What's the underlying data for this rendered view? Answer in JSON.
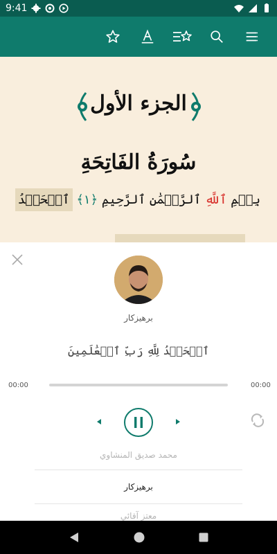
{
  "status_bar": {
    "time": "9:41",
    "left_icons": [
      "gear-icon",
      "at-sign-icon",
      "play-circle-icon"
    ],
    "right_icons": [
      "wifi-icon",
      "cellular-icon",
      "battery-icon"
    ]
  },
  "toolbar": {
    "actions": [
      "menu-icon",
      "search-icon",
      "starred-list-icon",
      "font-icon",
      "star-icon"
    ],
    "background": "#0f7b6c"
  },
  "reader": {
    "juz_title": "الجزء الأول",
    "surah_title": "سُورَةُ الفَاتِحَةِ",
    "verse_basmala_start": "بِسۡمِ",
    "verse_allah": "ٱللَّهِ",
    "verse_basmala_end": "ٱلرَّحۡمَٰنِ ٱلرَّحِيمِ",
    "ayah_number": "﴿١﴾",
    "verse_next_word": "ٱلۡحَمۡدُ",
    "background": "#f9eedd",
    "allah_color": "#d8332e"
  },
  "player": {
    "reciter_caption": "برهيزكار",
    "current_verse": "ٱلۡحَمۡدُ لِلَّهِ رَبِّ ٱلۡعَٰلَمِينَ",
    "elapsed": "00:00",
    "duration": "00:00",
    "progress": 0,
    "accent": "#0f7b6c",
    "reciters": [
      "محمد صديق المنشاوي",
      "برهيزكار",
      "معتز آقائي"
    ],
    "selected_reciter_index": 1
  },
  "nav_bar": {
    "buttons": [
      "back-icon",
      "home-icon",
      "recents-icon"
    ]
  }
}
